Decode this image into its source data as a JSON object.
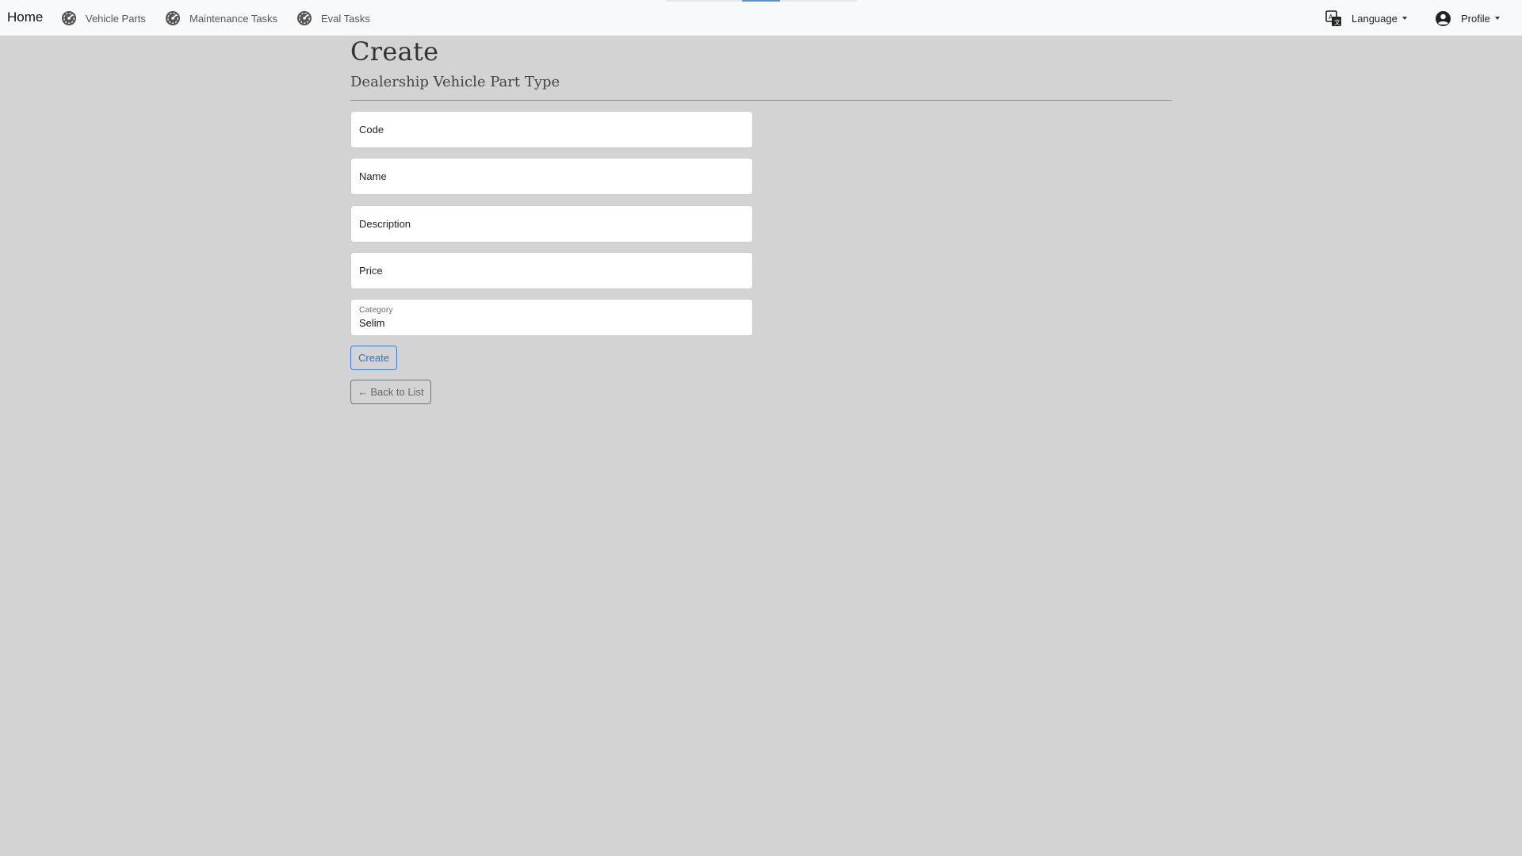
{
  "navbar": {
    "brand": "Home",
    "items": [
      {
        "label": "Vehicle Parts",
        "icon": "dashboard-gauge-icon"
      },
      {
        "label": "Maintenance Tasks",
        "icon": "dashboard-gauge-icon"
      },
      {
        "label": "Eval Tasks",
        "icon": "dashboard-gauge-icon"
      }
    ],
    "language": {
      "label": "Language",
      "icon": "translate-icon"
    },
    "profile": {
      "label": "Profile",
      "icon": "user-circle-icon"
    }
  },
  "page": {
    "title": "Create",
    "subtitle": "Dealership Vehicle Part Type"
  },
  "form": {
    "code": {
      "placeholder": "Code",
      "value": ""
    },
    "name": {
      "placeholder": "Name",
      "value": ""
    },
    "description": {
      "placeholder": "Description",
      "value": ""
    },
    "price": {
      "placeholder": "Price",
      "value": ""
    },
    "category": {
      "label": "Category",
      "value": "Selim"
    },
    "create_label": "Create",
    "back_label": "Back to List",
    "back_icon": "arrow-left-icon"
  },
  "colors": {
    "background": "#d3d3d3",
    "navbar": "#f8f9fa",
    "primary": "#3b7ddd",
    "secondary": "#6c757d"
  }
}
